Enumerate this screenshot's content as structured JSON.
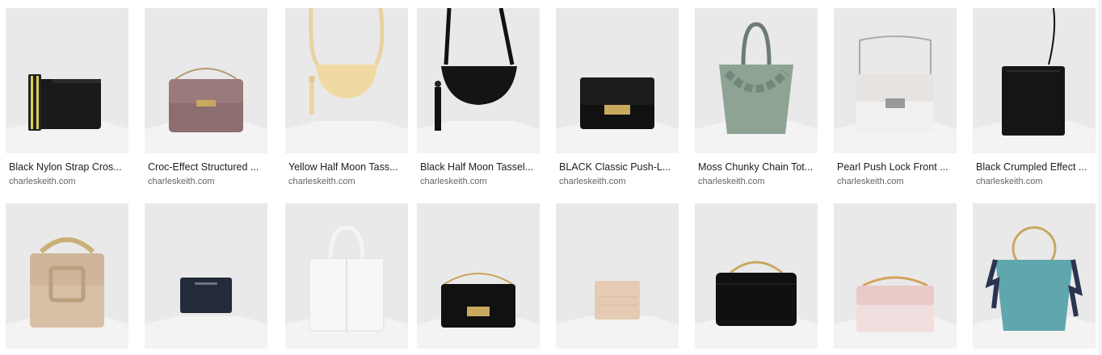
{
  "results": [
    {
      "title": "Black Nylon Strap Cros...",
      "source": "charleskeith.com",
      "icon": "black-crossbody-bag-strap"
    },
    {
      "title": "Croc-Effect Structured ...",
      "source": "charleskeith.com",
      "icon": "mauve-croc-chain-bag"
    },
    {
      "title": "Yellow Half Moon Tass...",
      "source": "charleskeith.com",
      "icon": "yellow-half-moon-bag"
    },
    {
      "title": "Black Half Moon Tassel...",
      "source": "charleskeith.com",
      "icon": "black-half-moon-bag"
    },
    {
      "title": "BLACK Classic Push-L...",
      "source": "charleskeith.com",
      "icon": "black-push-lock-bag"
    },
    {
      "title": "Moss Chunky Chain Tot...",
      "source": "charleskeith.com",
      "icon": "moss-chain-tote"
    },
    {
      "title": "Pearl Push Lock Front ...",
      "source": "charleskeith.com",
      "icon": "pearl-push-lock-bag"
    },
    {
      "title": "Black Crumpled Effect ...",
      "source": "charleskeith.com",
      "icon": "black-crumpled-bag"
    },
    {
      "title": "",
      "source": "",
      "icon": "beige-top-handle-bag"
    },
    {
      "title": "",
      "source": "",
      "icon": "navy-card-wallet"
    },
    {
      "title": "",
      "source": "",
      "icon": "white-tote"
    },
    {
      "title": "",
      "source": "",
      "icon": "black-croc-chain-bag"
    },
    {
      "title": "",
      "source": "",
      "icon": "beige-card-holder"
    },
    {
      "title": "",
      "source": "",
      "icon": "black-chain-shoulder-bag"
    },
    {
      "title": "",
      "source": "",
      "icon": "pink-chain-bag"
    },
    {
      "title": "",
      "source": "",
      "icon": "teal-bucket-bag"
    }
  ],
  "colors": {
    "title": "#202124",
    "source": "#5f6368",
    "thumb_bg": "#e9e9e9"
  }
}
